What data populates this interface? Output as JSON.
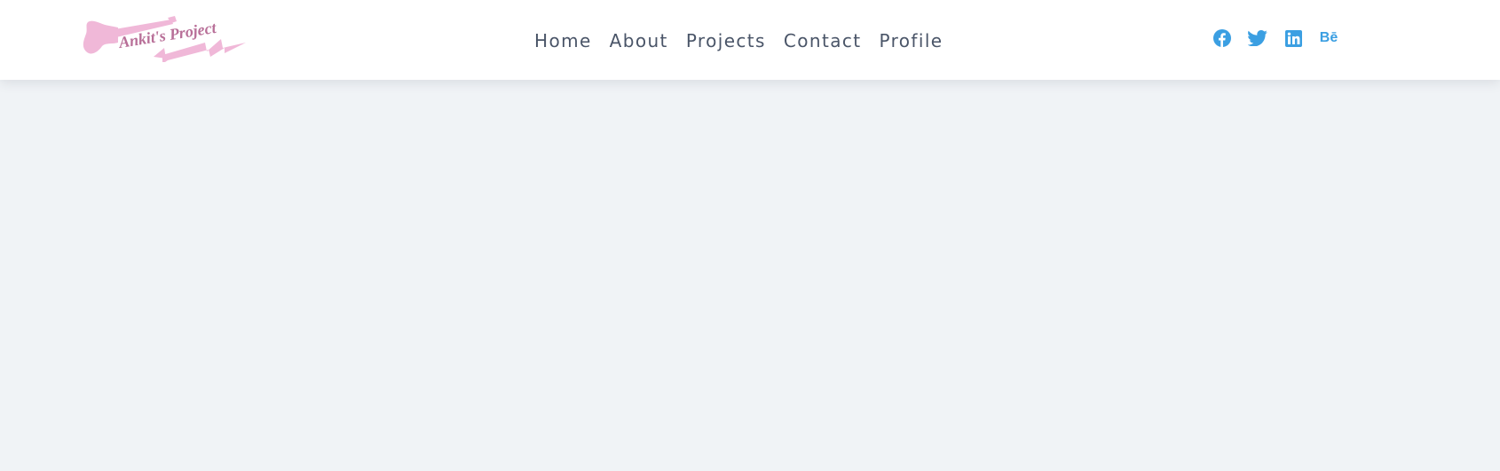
{
  "brand": {
    "logo_text": "Ankit's Project",
    "logo_color": "#f0b8d8",
    "logo_text_color": "#b86f98"
  },
  "nav": {
    "items": [
      {
        "label": "Home"
      },
      {
        "label": "About"
      },
      {
        "label": "Projects"
      },
      {
        "label": "Contact"
      },
      {
        "label": "Profile"
      }
    ],
    "color": "#4a5568"
  },
  "social": {
    "color": "#3b9fe2",
    "icons": [
      "facebook-icon",
      "twitter-icon",
      "linkedin-icon",
      "behance-icon"
    ],
    "behance_label": "Bē"
  },
  "page": {
    "background": "#f0f3f6",
    "header_background": "#ffffff"
  }
}
